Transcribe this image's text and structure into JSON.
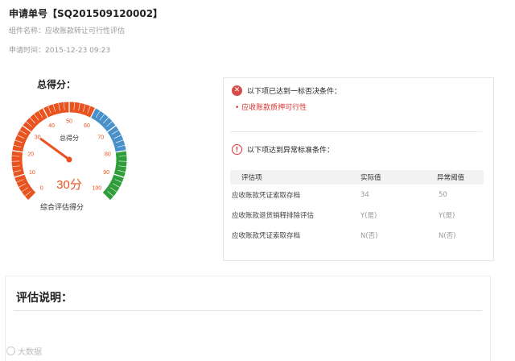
{
  "header": {
    "title": "申请单号【SQ201509120002】",
    "component_line": "组件名称：应收账款转让可行性评估",
    "time_line": "申请时间：2015-12-23 09:23"
  },
  "score": {
    "label": "总得分：",
    "gauge_title": "总得分",
    "value_text": "30分",
    "value": 30,
    "min": 0,
    "max": 100,
    "caption": "综合评估得分",
    "ticks": [
      "0",
      "10",
      "20",
      "30",
      "40",
      "50",
      "60",
      "70",
      "80",
      "90",
      "100"
    ],
    "colors": {
      "low": "#e8531f",
      "mid": "#4a90c8",
      "high": "#2e9d3a",
      "needle": "#e8531f"
    }
  },
  "veto": {
    "heading": "以下项已达到一标否决条件：",
    "item": "应收账款质押可行性"
  },
  "abnormal": {
    "heading": "以下项达到异常标准条件：",
    "columns": [
      "评估项",
      "实际值",
      "异常阈值"
    ],
    "rows": [
      {
        "item": "应收账款凭证索取存档",
        "actual": "34",
        "threshold": "50"
      },
      {
        "item": "应收账款退货销释排除评估",
        "actual": "Y(是)",
        "threshold": "Y(是)"
      },
      {
        "item": "应收账款凭证索取存档",
        "actual": "N(否)",
        "threshold": "N(否)"
      }
    ]
  },
  "explain": {
    "title": "评估说明："
  },
  "watermark": {
    "text": "大数据"
  }
}
